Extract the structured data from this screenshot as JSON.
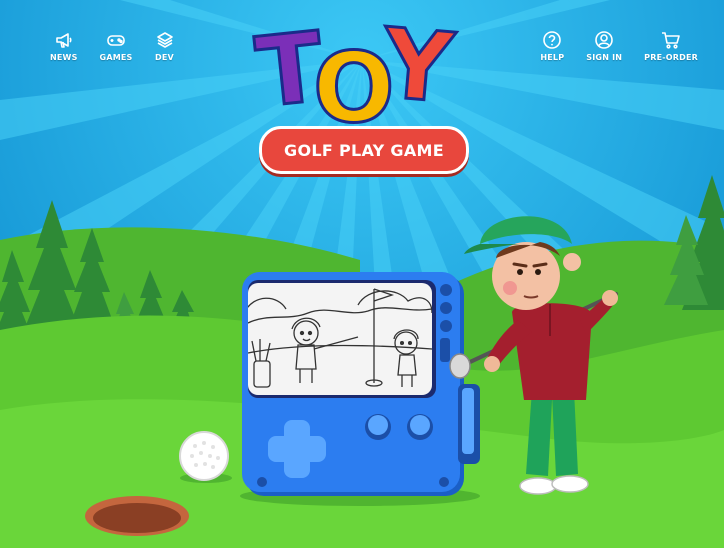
{
  "nav_left": [
    {
      "label": "NEWS",
      "icon": "megaphone-icon"
    },
    {
      "label": "GAMES",
      "icon": "gamepad-icon"
    },
    {
      "label": "DEV",
      "icon": "layers-icon"
    }
  ],
  "nav_right": [
    {
      "label": "HELP",
      "icon": "help-icon"
    },
    {
      "label": "SIGN IN",
      "icon": "user-icon"
    },
    {
      "label": "PRE-ORDER",
      "icon": "cart-icon"
    }
  ],
  "logo": {
    "letters": [
      "T",
      "O",
      "Y"
    ],
    "subtitle": "GOLF PLAY GAME"
  },
  "colors": {
    "sky": "#1aa5e0",
    "sky_ray": "#27b9ef",
    "grass_light": "#5ec932",
    "grass_dark": "#41a52a",
    "console_blue": "#2c7df0",
    "logo_purple": "#7b2fb8",
    "logo_yellow": "#f8b800",
    "logo_red": "#ef4a3a",
    "pill_red": "#e8473d"
  }
}
